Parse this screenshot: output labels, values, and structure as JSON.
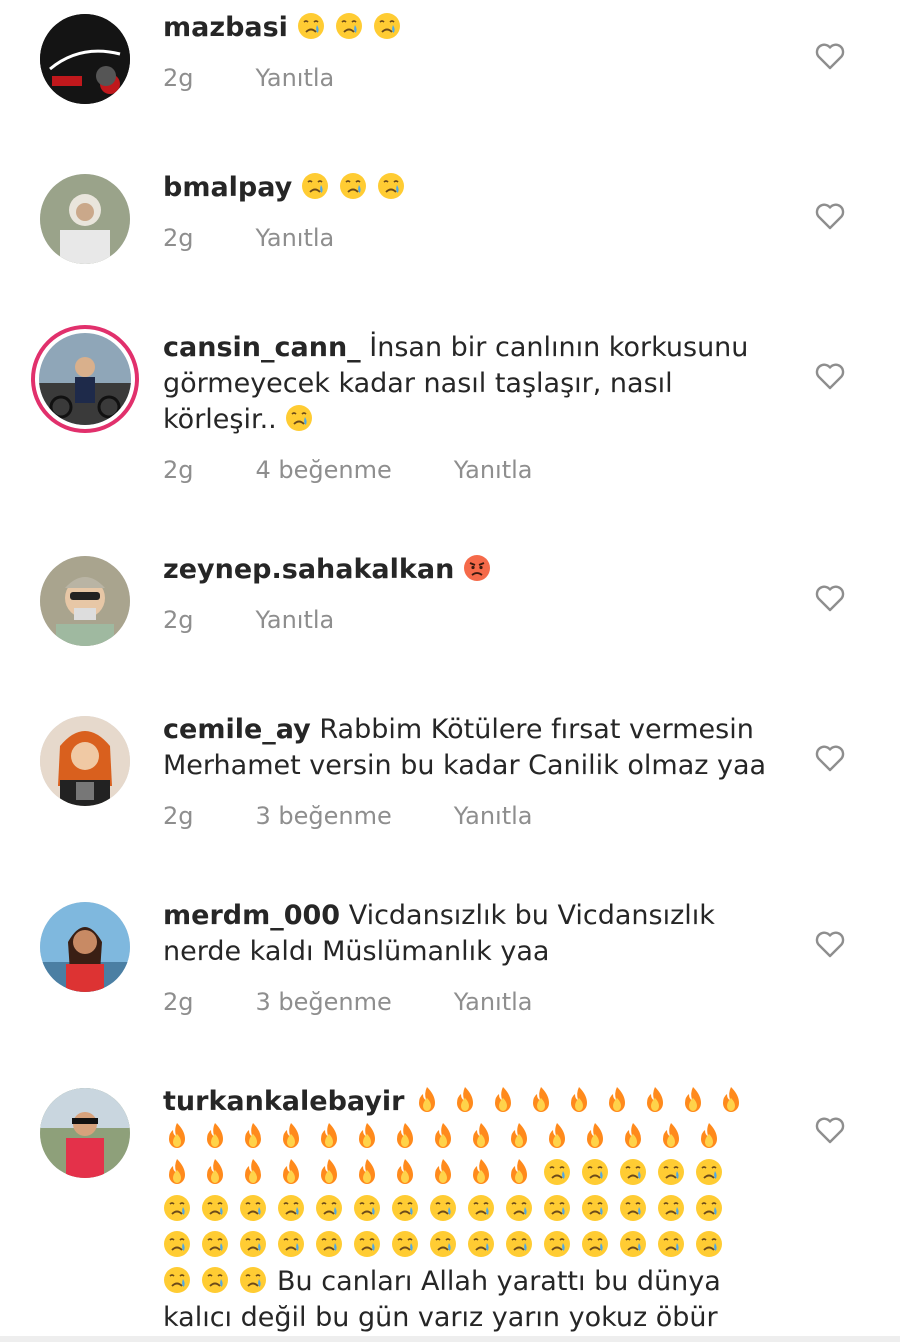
{
  "comments": [
    {
      "username": "mazbasi",
      "text": "",
      "emojis_after": [
        "cry",
        "cry",
        "cry"
      ],
      "time": "2g",
      "likes": "",
      "reply": "Yanıtla"
    },
    {
      "username": "bmalpay",
      "text": "",
      "emojis_after": [
        "cry",
        "cry",
        "cry"
      ],
      "time": "2g",
      "likes": "",
      "reply": "Yanıtla"
    },
    {
      "username": "cansin_cann_",
      "text": "İnsan bir canlının korkusunu görmeyecek kadar nasıl taşlaşır, nasıl körleşir..",
      "emojis_after": [
        "cry"
      ],
      "time": "2g",
      "likes": "4 beğenme",
      "reply": "Yanıtla"
    },
    {
      "username": "zeynep.sahakalkan",
      "text": "",
      "emojis_after": [
        "angry"
      ],
      "time": "2g",
      "likes": "",
      "reply": "Yanıtla"
    },
    {
      "username": "cemile_ay",
      "text": "Rabbim Kötülere fırsat vermesin Merhamet versin bu kadar Canilik olmaz yaa",
      "emojis_after": [],
      "time": "2g",
      "likes": "3 beğenme",
      "reply": "Yanıtla"
    },
    {
      "username": "merdm_000",
      "text": "Vicdansızlık bu Vicdansızlık nerde kaldı Müslümanlık yaa",
      "emojis_after": [],
      "time": "2g",
      "likes": "3 beğenme",
      "reply": "Yanıtla"
    },
    {
      "username": "turkankalebayir",
      "line1_emojis": [
        "fire",
        "fire",
        "fire",
        "fire",
        "fire",
        "fire",
        "fire",
        "fire",
        "fire"
      ],
      "emoji_rows": [
        [
          "fire",
          "fire",
          "fire",
          "fire",
          "fire",
          "fire",
          "fire",
          "fire",
          "fire",
          "fire",
          "fire",
          "fire",
          "fire",
          "fire",
          "fire"
        ],
        [
          "fire",
          "fire",
          "fire",
          "fire",
          "fire",
          "fire",
          "fire",
          "fire",
          "fire",
          "fire",
          "cry",
          "cry",
          "cry",
          "cry",
          "cry"
        ],
        [
          "cry",
          "cry",
          "cry",
          "cry",
          "cry",
          "cry",
          "cry",
          "cry",
          "cry",
          "cry",
          "cry",
          "cry",
          "cry",
          "cry",
          "cry"
        ],
        [
          "cry",
          "cry",
          "cry",
          "cry",
          "cry",
          "cry",
          "cry",
          "cry",
          "cry",
          "cry",
          "cry",
          "cry",
          "cry",
          "cry",
          "cry"
        ]
      ],
      "tail_emojis": [
        "cry",
        "cry",
        "cry"
      ],
      "text": "Bu canları Allah yarattı bu dünya",
      "text2": "kalıcı değil bu gün varız yarın yokuz öbür"
    }
  ],
  "colors": {
    "username": "#262626",
    "meta": "#8e8e8e",
    "story_ring": "#e1306c",
    "heart": "#8e8e8e"
  }
}
